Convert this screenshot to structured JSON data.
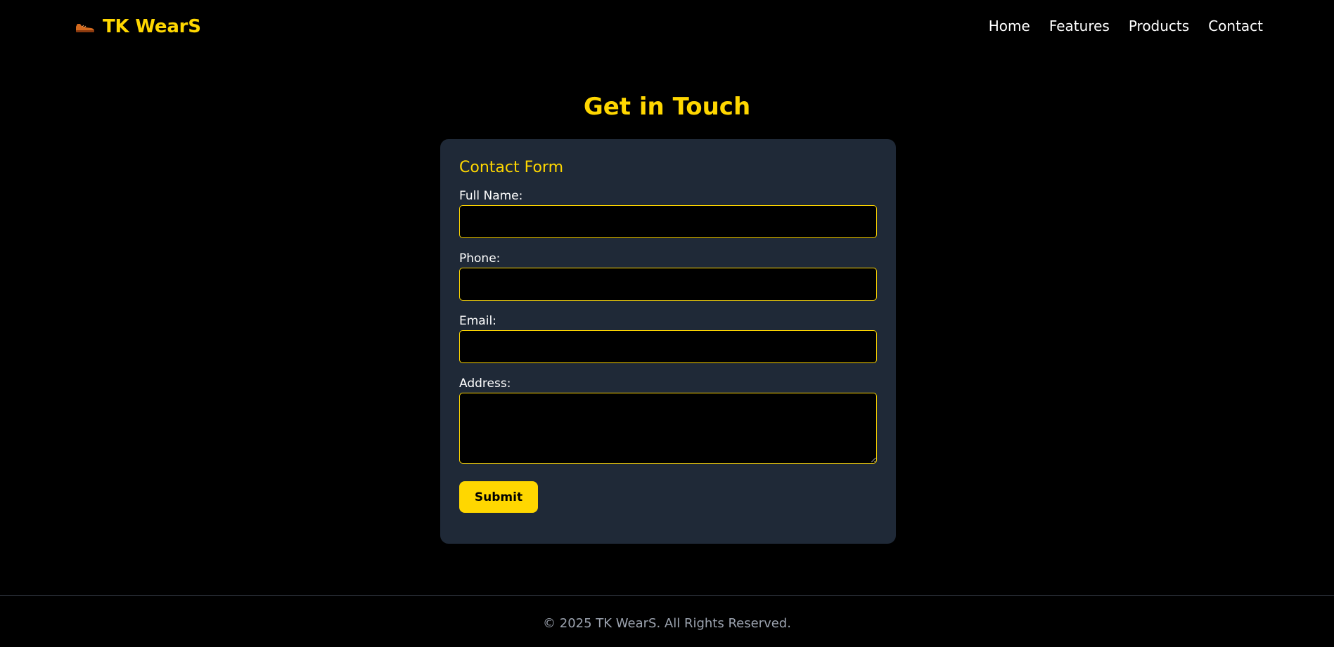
{
  "header": {
    "brand": "TK WearS",
    "brand_icon": "shoe-icon",
    "nav": [
      "Home",
      "Features",
      "Products",
      "Contact"
    ]
  },
  "main": {
    "title": "Get in Touch"
  },
  "form": {
    "title": "Contact Form",
    "full_name_label": "Full Name:",
    "full_name_value": "",
    "phone_label": "Phone:",
    "phone_value": "",
    "email_label": "Email:",
    "email_value": "",
    "address_label": "Address:",
    "address_value": "",
    "submit_label": "Submit"
  },
  "footer": {
    "text": "© 2025 TK WearS. All Rights Reserved."
  },
  "colors": {
    "accent": "#FFD700",
    "background": "#000000",
    "card": "#1f2937"
  }
}
